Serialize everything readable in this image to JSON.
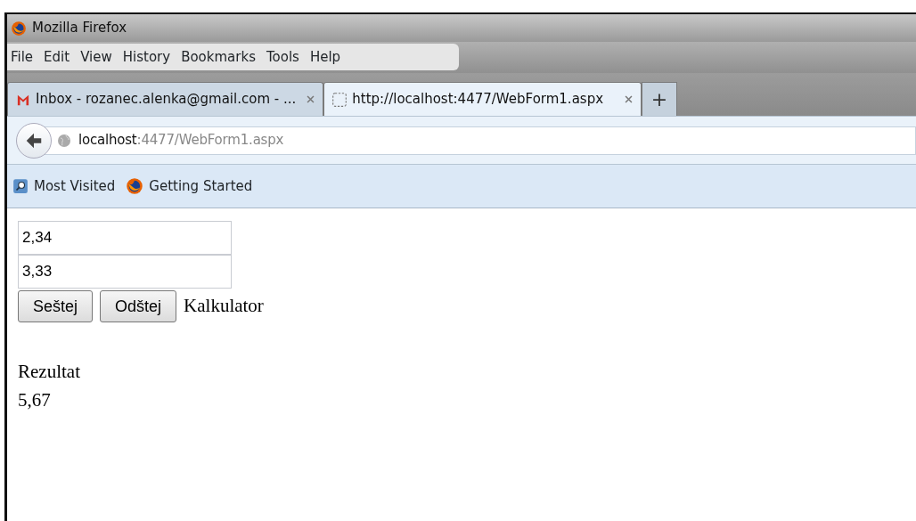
{
  "window": {
    "title": "Mozilla Firefox"
  },
  "menu": [
    "File",
    "Edit",
    "View",
    "History",
    "Bookmarks",
    "Tools",
    "Help"
  ],
  "tabs": [
    {
      "label": "Inbox - rozanec.alenka@gmail.com - ...",
      "selected": false,
      "kind": "mail"
    },
    {
      "label": "http://localhost:4477/WebForm1.aspx",
      "selected": true,
      "kind": "blank"
    }
  ],
  "new_tab": "+",
  "address": {
    "host": "localhost",
    "rest": ":4477/WebForm1.aspx"
  },
  "bookmarks": [
    {
      "label": "Most Visited",
      "kind": "search"
    },
    {
      "label": "Getting Started",
      "kind": "firefox"
    }
  ],
  "form": {
    "fields": [
      "2,34",
      "3,33"
    ],
    "buttons": [
      "Seštej",
      "Odštej"
    ],
    "caption": "Kalkulator",
    "result_label": "Rezultat",
    "result": "5,67"
  }
}
